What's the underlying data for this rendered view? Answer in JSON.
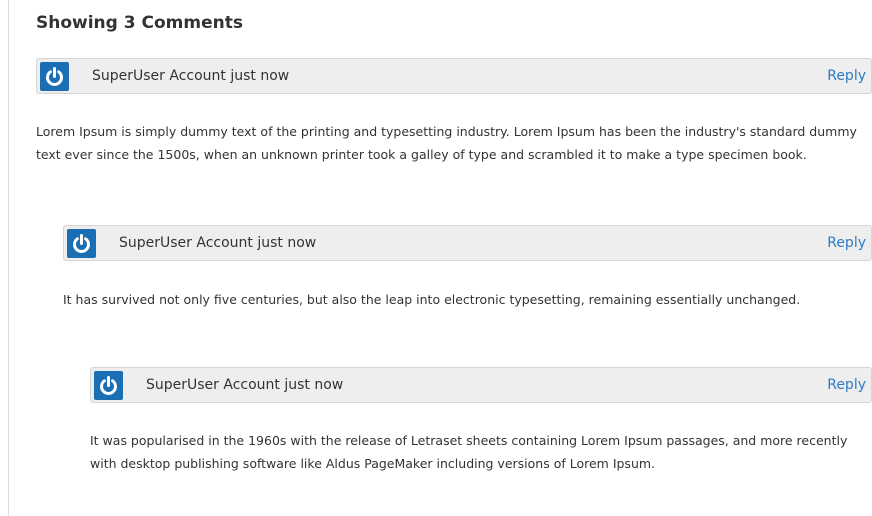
{
  "comments_section": {
    "heading": "Showing 3 Comments",
    "comments": [
      {
        "author": "SuperUser Account",
        "time": "just now",
        "reply_label": "Reply",
        "avatar_icon": "power-icon",
        "body": "Lorem Ipsum is simply dummy text of the printing and typesetting industry. Lorem Ipsum has been the industry's standard dummy text ever since the 1500s, when an unknown printer took a galley of type and scrambled it to make a type specimen book."
      },
      {
        "author": "SuperUser Account",
        "time": "just now",
        "reply_label": "Reply",
        "avatar_icon": "power-icon",
        "body": "It has survived not only five centuries, but also the leap into electronic typesetting, remaining essentially unchanged."
      },
      {
        "author": "SuperUser Account",
        "time": "just now",
        "reply_label": "Reply",
        "avatar_icon": "power-icon",
        "body": "It was popularised in the 1960s with the release of Letraset sheets containing Lorem Ipsum passages, and more recently with desktop publishing software like Aldus PageMaker including versions of Lorem Ipsum."
      }
    ]
  },
  "colors": {
    "avatar_background": "#1a6eb4",
    "reply_link": "#2d7bc4",
    "header_background": "#eeeeee"
  }
}
